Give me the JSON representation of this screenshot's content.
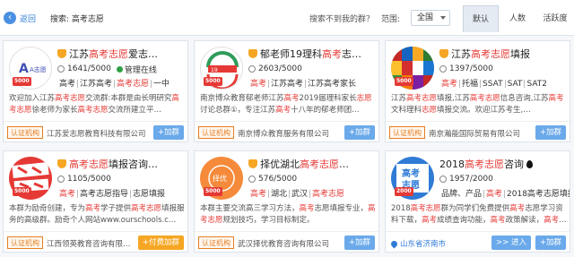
{
  "topbar": {
    "back_label": "返回",
    "search_text": "搜索: 高考志愿",
    "notfound_label": "搜索不到我的群？",
    "range_label": "范围:",
    "range_value": "全国",
    "sort_tabs": [
      "默认",
      "人数",
      "活跃度"
    ]
  },
  "cards": [
    {
      "title_prefix": "江苏",
      "title_hl": "高考志愿",
      "title_suffix": "爱志…",
      "members": "1641/5000",
      "managed": "管理在线",
      "tags": [
        "高考",
        "江苏高考",
        "高考志愿",
        "一中"
      ],
      "desc_parts": [
        "欢迎加入江苏",
        "高考志愿",
        "交流群:本群是由长明研究",
        "高考志愿",
        "徐老师为家长",
        "高考志愿",
        "交流所建立平…"
      ],
      "auth": "认证机构",
      "company": "江苏爱志愿教育科技有限公司",
      "join": "+加群",
      "avatar_num": "5000"
    },
    {
      "title_prefix": "郁老师19理科",
      "title_hl": "高考",
      "title_suffix": "志…",
      "members": "2603/5000",
      "tags": [
        "高考",
        "江苏高考",
        "江苏高考家长"
      ],
      "desc_parts": [
        "南京博众教育郁老师江苏",
        "高考",
        "2019届理科家长",
        "志愿",
        "讨论总群①，专注江苏",
        "高考",
        "十八年的郁老师团…"
      ],
      "auth": "认证机构",
      "company": "南京博众教育服务有限公司",
      "join": "+加群",
      "avatar_num": "5000"
    },
    {
      "title_prefix": "江苏",
      "title_hl": "高考志愿",
      "title_suffix": "填报",
      "members": "1397/5000",
      "tags": [
        "高考",
        "托福",
        "SSAT",
        "SAT",
        "SAT2"
      ],
      "desc_parts": [
        "江苏",
        "高考志愿",
        "填报,江苏",
        "高考志愿",
        "信息咨询,江苏",
        "高考",
        "文科理科",
        "志愿",
        "填报交流。欢迎江苏考生,…"
      ],
      "auth": "认证机构",
      "company": "南京瀚能国际贸易有限公司",
      "join": "+加群",
      "avatar_num": "5000"
    },
    {
      "title_prefix": "",
      "title_hl": "高考志愿",
      "title_suffix": "填报咨询…",
      "members": "1105/5000",
      "tags": [
        "高考",
        "高考志愿指导",
        "志愿填报"
      ],
      "desc_parts": [
        "本群为励奇创建，专为",
        "高考",
        "学子提供",
        "高考志愿",
        "填报服务的高级群。励奇个人网站www.ourschools.c…"
      ],
      "auth": "认证机构",
      "company": "江西领英教育咨询有限…",
      "join": "+付费加群",
      "avatar_num": "5000",
      "paid": true
    },
    {
      "title_prefix": "择优湖北",
      "title_hl": "高考志愿",
      "title_suffix": "…",
      "members": "576/5000",
      "tags": [
        "高考",
        "湖北",
        "武汉",
        "高考志愿"
      ],
      "desc_parts": [
        "本群主要交流高三学习方法，",
        "高考",
        "志愿填报专业，",
        "高考志愿",
        "规划技巧，学习目标制定。"
      ],
      "auth": "认证机构",
      "company": "武汉择优教育咨询有限公司",
      "join": "+加群",
      "avatar_num": "5000"
    },
    {
      "title_prefix": "2018",
      "title_hl": "高考志愿",
      "title_suffix": "咨询",
      "members": "1957/2000",
      "tags": [
        "品牌、产品",
        "高考",
        "2018高考志愿填报"
      ],
      "desc_parts": [
        "2018",
        "高考志愿",
        "群为同学们免费提供",
        "高考",
        "志愿学习资料下载，",
        "高考",
        "成绩查询功能，",
        "高考",
        "政策解读，",
        "高考",
        "…"
      ],
      "location": "山东省济南市",
      "enter": "进入",
      "join": "+加群",
      "avatar_num": "2000"
    }
  ]
}
